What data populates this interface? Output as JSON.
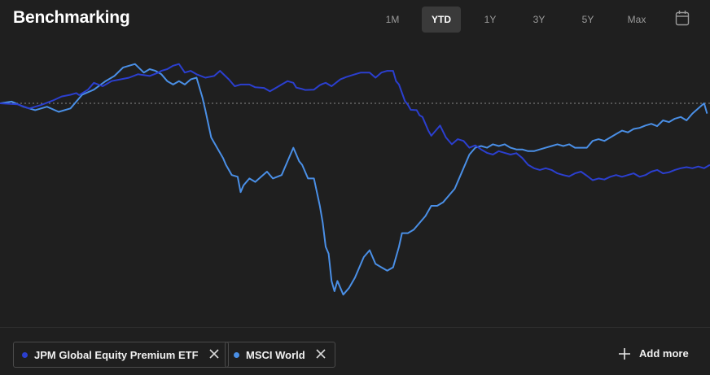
{
  "header": {
    "title": "Benchmarking",
    "ranges": [
      "1M",
      "YTD",
      "1Y",
      "3Y",
      "5Y",
      "Max"
    ],
    "active_range": "YTD",
    "calendar_icon": "calendar-icon"
  },
  "legend": {
    "items": [
      {
        "label": "JPM Global Equity Premium ETF",
        "color": "#2b3fcf"
      },
      {
        "label": "MSCI World",
        "color": "#4a8fe6"
      }
    ],
    "add_more_label": "Add more"
  },
  "chart_data": {
    "type": "line",
    "baseline": 0,
    "x_count": 200,
    "series": [
      {
        "name": "JPM Global Equity Premium ETF",
        "color": "#2b3fcf",
        "points": [
          [
            0,
            0
          ],
          [
            6,
            -0.3
          ],
          [
            10,
            -1.5
          ],
          [
            14,
            -0.5
          ],
          [
            18,
            0.8
          ],
          [
            21,
            2
          ],
          [
            24,
            2.5
          ],
          [
            26,
            3
          ],
          [
            27,
            2.4
          ],
          [
            30,
            4
          ],
          [
            32,
            6
          ],
          [
            35,
            5
          ],
          [
            38,
            6.5
          ],
          [
            41,
            7
          ],
          [
            44,
            7.5
          ],
          [
            47,
            8.5
          ],
          [
            51,
            8
          ],
          [
            54,
            9
          ],
          [
            55,
            9.5
          ],
          [
            57,
            10
          ],
          [
            59,
            11
          ],
          [
            61,
            11.5
          ],
          [
            63,
            9
          ],
          [
            65,
            9.5
          ],
          [
            67,
            8.5
          ],
          [
            70,
            7.5
          ],
          [
            73,
            8
          ],
          [
            75,
            9.5
          ],
          [
            78,
            7
          ],
          [
            80,
            5
          ],
          [
            82,
            5.5
          ],
          [
            85,
            5.5
          ],
          [
            87,
            4.7
          ],
          [
            90,
            4.5
          ],
          [
            92,
            3.5
          ],
          [
            94,
            4.5
          ],
          [
            96,
            5.5
          ],
          [
            98,
            6.5
          ],
          [
            100,
            6
          ],
          [
            101,
            4.6
          ],
          [
            103,
            4.2
          ],
          [
            104,
            3.9
          ],
          [
            107,
            4
          ],
          [
            109,
            5.3
          ],
          [
            110,
            5.7
          ],
          [
            111,
            6
          ],
          [
            113,
            5
          ],
          [
            116,
            7
          ],
          [
            118,
            7.7
          ],
          [
            121,
            8.5
          ],
          [
            123,
            9
          ],
          [
            126,
            9
          ],
          [
            128,
            7.5
          ],
          [
            130,
            9
          ],
          [
            132,
            9.5
          ],
          [
            134,
            9.5
          ],
          [
            135,
            6.5
          ],
          [
            136,
            5.5
          ],
          [
            138,
            0.7
          ],
          [
            139,
            -0.4
          ],
          [
            140,
            -1.9
          ],
          [
            142,
            -2
          ],
          [
            143,
            -3.5
          ],
          [
            144,
            -4
          ],
          [
            145,
            -6
          ],
          [
            146,
            -8
          ],
          [
            147,
            -9.5
          ],
          [
            149,
            -7.5
          ],
          [
            150,
            -6.5
          ],
          [
            152,
            -10
          ],
          [
            154,
            -12
          ],
          [
            156,
            -10.5
          ],
          [
            158,
            -11
          ],
          [
            160,
            -13
          ],
          [
            162,
            -12.3
          ],
          [
            164,
            -13.5
          ],
          [
            166,
            -14.5
          ],
          [
            168,
            -15
          ],
          [
            170,
            -14
          ],
          [
            172,
            -14.5
          ],
          [
            174,
            -15
          ],
          [
            176,
            -14.6
          ],
          [
            178,
            -16
          ],
          [
            180,
            -18
          ],
          [
            182,
            -19
          ],
          [
            184,
            -19.5
          ],
          [
            186,
            -19
          ],
          [
            188,
            -19.5
          ],
          [
            190,
            -20.5
          ],
          [
            192,
            -21
          ],
          [
            194,
            -21.4
          ],
          [
            196,
            -20.5
          ],
          [
            198,
            -20
          ],
          [
            200,
            -21.2
          ],
          [
            202,
            -22.5
          ],
          [
            204,
            -22
          ],
          [
            206,
            -22.3
          ],
          [
            208,
            -21.5
          ],
          [
            210,
            -21
          ],
          [
            212,
            -21.5
          ],
          [
            214,
            -21
          ],
          [
            216,
            -20.5
          ],
          [
            218,
            -21.5
          ],
          [
            220,
            -21
          ],
          [
            222,
            -20
          ],
          [
            224,
            -19.5
          ],
          [
            226,
            -20.5
          ],
          [
            228,
            -20.2
          ],
          [
            230,
            -19.5
          ],
          [
            232,
            -19
          ],
          [
            234,
            -18.7
          ],
          [
            236,
            -19
          ],
          [
            238,
            -18.5
          ],
          [
            240,
            -19
          ],
          [
            242,
            -18
          ]
        ]
      },
      {
        "name": "MSCI World",
        "color": "#4a8fe6",
        "points": [
          [
            0,
            0
          ],
          [
            4,
            0.5
          ],
          [
            8,
            -1
          ],
          [
            12,
            -2
          ],
          [
            16,
            -1
          ],
          [
            20,
            -2.5
          ],
          [
            24,
            -1.5
          ],
          [
            28,
            2.5
          ],
          [
            32,
            4
          ],
          [
            36,
            6.5
          ],
          [
            39,
            8
          ],
          [
            42,
            10.5
          ],
          [
            46,
            11.5
          ],
          [
            49,
            9
          ],
          [
            51,
            10
          ],
          [
            53,
            9.5
          ],
          [
            55,
            8.5
          ],
          [
            57,
            6.5
          ],
          [
            59,
            5.5
          ],
          [
            61,
            6.5
          ],
          [
            63,
            5.5
          ],
          [
            65,
            7
          ],
          [
            67,
            7.5
          ],
          [
            69,
            1.7
          ],
          [
            70,
            -2
          ],
          [
            72,
            -10
          ],
          [
            74,
            -13
          ],
          [
            76,
            -16
          ],
          [
            77,
            -18
          ],
          [
            79,
            -21
          ],
          [
            81,
            -21.5
          ],
          [
            82,
            -26
          ],
          [
            83,
            -24
          ],
          [
            85,
            -22
          ],
          [
            87,
            -23
          ],
          [
            89,
            -21.5
          ],
          [
            91,
            -20
          ],
          [
            93,
            -22
          ],
          [
            96,
            -21
          ],
          [
            98,
            -17
          ],
          [
            100,
            -13
          ],
          [
            102,
            -17
          ],
          [
            103,
            -18
          ],
          [
            105,
            -22
          ],
          [
            107,
            -22
          ],
          [
            109,
            -30
          ],
          [
            110,
            -35
          ],
          [
            111,
            -42
          ],
          [
            112,
            -44
          ],
          [
            113,
            -52
          ],
          [
            114,
            -55
          ],
          [
            115,
            -52
          ],
          [
            116,
            -54
          ],
          [
            117,
            -56
          ],
          [
            119,
            -54
          ],
          [
            121,
            -51
          ],
          [
            123,
            -47
          ],
          [
            124,
            -45
          ],
          [
            126,
            -43
          ],
          [
            128,
            -47
          ],
          [
            130,
            -48
          ],
          [
            132,
            -49
          ],
          [
            134,
            -48
          ],
          [
            135,
            -45
          ],
          [
            136,
            -42
          ],
          [
            137,
            -38
          ],
          [
            139,
            -38
          ],
          [
            141,
            -37
          ],
          [
            143,
            -35
          ],
          [
            145,
            -33
          ],
          [
            147,
            -30
          ],
          [
            149,
            -30
          ],
          [
            151,
            -29
          ],
          [
            153,
            -27
          ],
          [
            155,
            -25
          ],
          [
            157,
            -21
          ],
          [
            159,
            -17
          ],
          [
            160,
            -15
          ],
          [
            162,
            -13
          ],
          [
            164,
            -12.5
          ],
          [
            166,
            -13
          ],
          [
            168,
            -12
          ],
          [
            170,
            -12.5
          ],
          [
            172,
            -12
          ],
          [
            174,
            -13
          ],
          [
            176,
            -13.5
          ],
          [
            178,
            -13.5
          ],
          [
            180,
            -14
          ],
          [
            182,
            -14
          ],
          [
            184,
            -13.5
          ],
          [
            186,
            -13
          ],
          [
            188,
            -12.5
          ],
          [
            190,
            -12
          ],
          [
            192,
            -12.5
          ],
          [
            194,
            -12
          ],
          [
            196,
            -13
          ],
          [
            198,
            -13
          ],
          [
            200,
            -13
          ],
          [
            202,
            -11
          ],
          [
            204,
            -10.5
          ],
          [
            206,
            -11
          ],
          [
            208,
            -10
          ],
          [
            210,
            -9
          ],
          [
            212,
            -8
          ],
          [
            214,
            -8.5
          ],
          [
            216,
            -7.5
          ],
          [
            218,
            -7.2
          ],
          [
            220,
            -6.5
          ],
          [
            222,
            -6
          ],
          [
            224,
            -6.7
          ],
          [
            226,
            -5
          ],
          [
            228,
            -5.5
          ],
          [
            230,
            -4.5
          ],
          [
            232,
            -4
          ],
          [
            234,
            -5
          ],
          [
            236,
            -3
          ],
          [
            238,
            -1.5
          ],
          [
            240,
            0
          ],
          [
            241,
            -3
          ]
        ]
      }
    ]
  }
}
